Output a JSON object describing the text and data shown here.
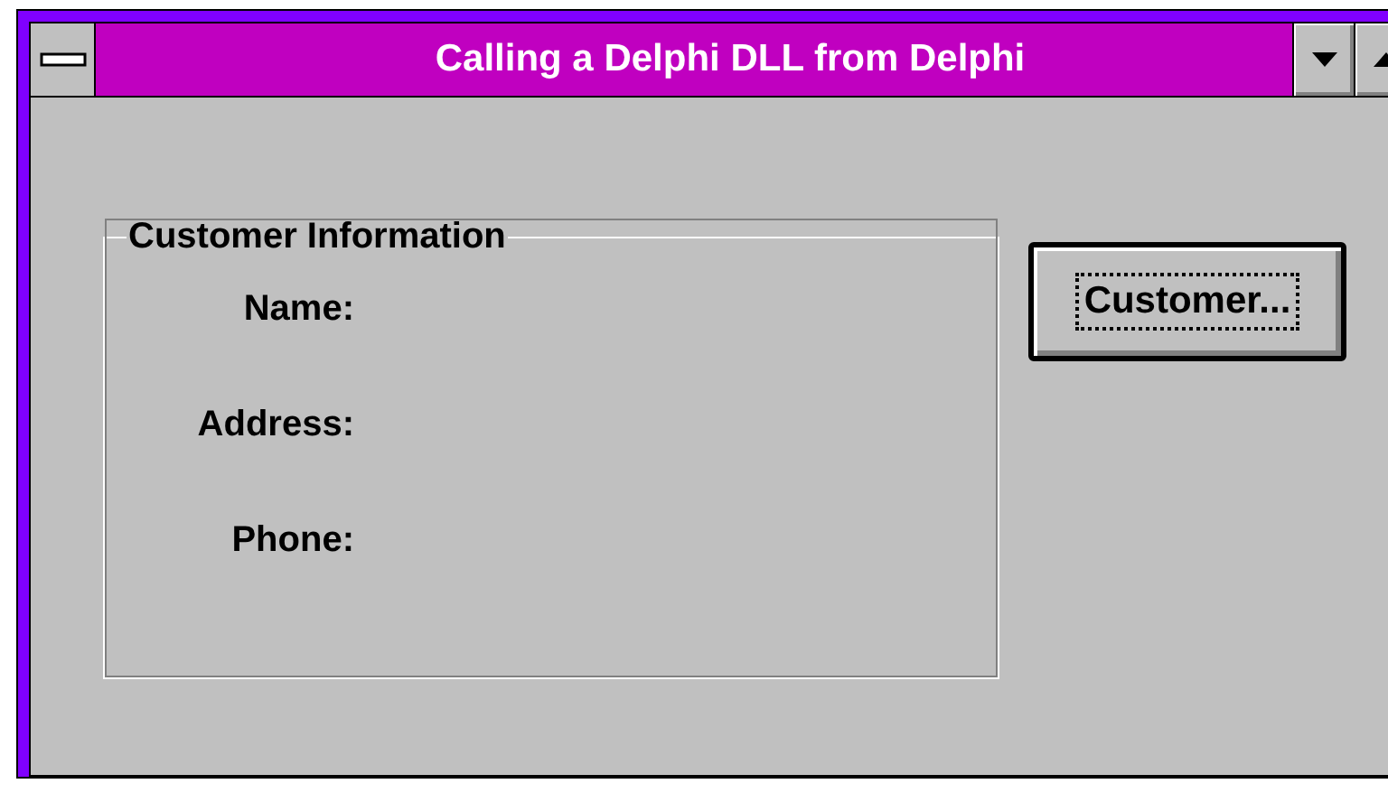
{
  "window": {
    "title": "Calling a Delphi DLL from Delphi"
  },
  "group": {
    "title": "Customer Information",
    "fields": [
      {
        "label": "Name:"
      },
      {
        "label": "Address:"
      },
      {
        "label": "Phone:"
      }
    ]
  },
  "buttons": [
    {
      "label": "Customer...",
      "focused": true
    }
  ]
}
